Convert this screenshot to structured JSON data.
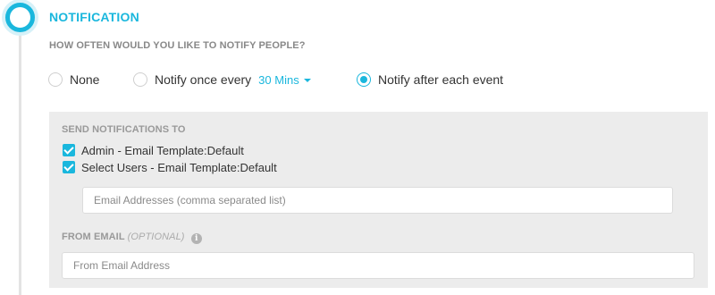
{
  "section": {
    "title": "NOTIFICATION",
    "question": "HOW OFTEN WOULD YOU LIKE TO NOTIFY PEOPLE?"
  },
  "frequency": {
    "options": [
      {
        "label": "None",
        "selected": false
      },
      {
        "label": "Notify once every",
        "selected": false,
        "interval": "30 Mins"
      },
      {
        "label": "Notify after each event",
        "selected": true
      }
    ]
  },
  "recipients": {
    "heading": "SEND NOTIFICATIONS TO",
    "checkboxes": [
      {
        "label": "Admin - Email Template:Default",
        "checked": true
      },
      {
        "label": "Select Users - Email Template:Default",
        "checked": true
      }
    ],
    "email_placeholder": "Email Addresses (comma separated list)"
  },
  "from_email": {
    "label": "FROM EMAIL",
    "optional": "(OPTIONAL)",
    "info_icon": "info-icon",
    "placeholder": "From Email Address"
  },
  "colors": {
    "accent": "#1ab7dd",
    "panel_bg": "#ececec"
  }
}
